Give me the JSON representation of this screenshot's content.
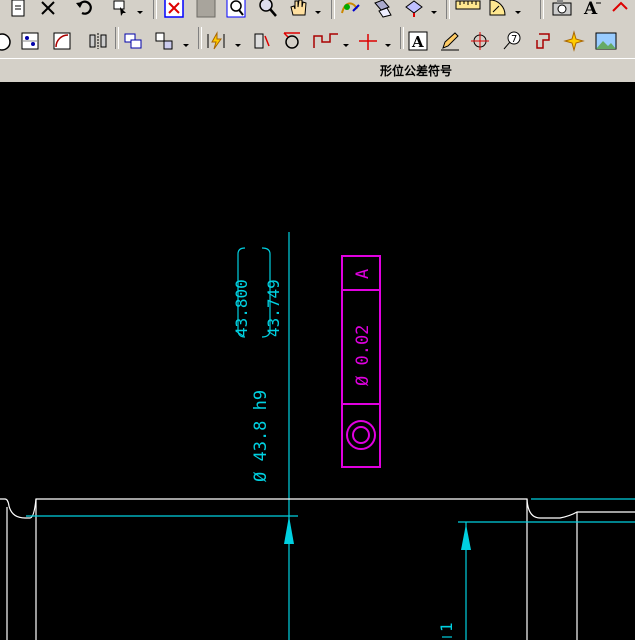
{
  "toolbar": {
    "row1_icons": [
      "new-file-icon",
      "delete-x-icon",
      "undo-icon",
      "layer-select-icon",
      "zoom-extent-icon",
      "grey-box-icon",
      "zoom-window-icon",
      "zoom-realtime-icon",
      "pan-hand-icon",
      "modify-tool-icon",
      "transform-tool-icon",
      "snap-tool-icon",
      "ruler-icon",
      "protractor-icon",
      "camera-icon",
      "text-a-icon",
      "extra-icon"
    ],
    "row2_icons": [
      "circle-icon",
      "point-grid-icon",
      "arc-icon",
      "mirror-icon",
      "group-icon",
      "offset-icon",
      "lightning-dim-icon",
      "radius-dim-icon",
      "tolerance-dim-icon",
      "profile-icon",
      "crosshair-icon",
      "text-box-icon",
      "pencil-icon",
      "target-icon",
      "balloon-icon",
      "bracket-icon",
      "sparkle-icon",
      "image-icon"
    ],
    "status_label": "形位公差符号"
  },
  "drawing": {
    "dim_text": "Ø 43.8 h9",
    "upper_deviation": "43.800",
    "lower_deviation": "43.749",
    "fcf_symbol": "concentricity",
    "fcf_tolerance": "Ø 0.02",
    "fcf_datum": "A",
    "right_dim_fragment": "1",
    "colors": {
      "dimension": "#00d0e0",
      "fcf": "#e000e0",
      "geometry": "#ffffff",
      "background": "#000000"
    }
  }
}
